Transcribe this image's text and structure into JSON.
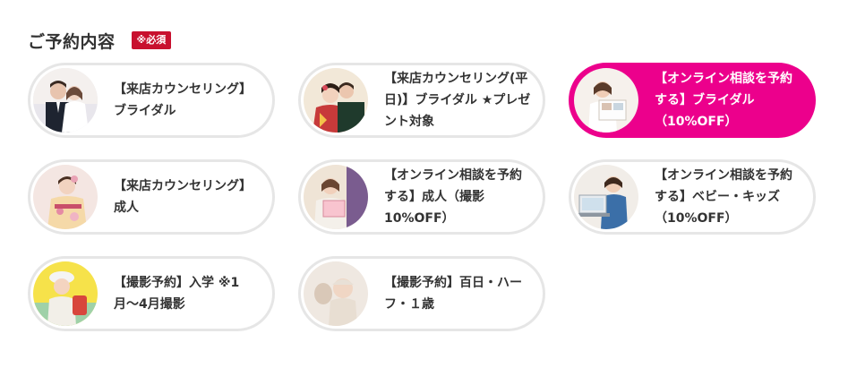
{
  "section": {
    "title": "ご予約内容",
    "required_badge": "※必須"
  },
  "options": [
    {
      "label": "【来店カウンセリング】ブライダル",
      "selected": false,
      "icon": "couple-photo"
    },
    {
      "label": "【来店カウンセリング(平日)】ブライダル ★プレゼント対象",
      "selected": false,
      "icon": "couple-kimono-photo"
    },
    {
      "label": "【オンライン相談を予約する】ブライダル（10%OFF）",
      "selected": true,
      "icon": "online-consult-photo"
    },
    {
      "label": "【来店カウンセリング】成人",
      "selected": false,
      "icon": "furisode-photo"
    },
    {
      "label": "【オンライン相談を予約する】成人（撮影10%OFF）",
      "selected": false,
      "icon": "furisode-online-photo"
    },
    {
      "label": "【オンライン相談を予約する】ベビー・キッズ（10%OFF）",
      "selected": false,
      "icon": "laptop-consult-photo"
    },
    {
      "label": "【撮影予約】入学 ※1月〜4月撮影",
      "selected": false,
      "icon": "school-kid-photo"
    },
    {
      "label": "【撮影予約】百日・ハーフ・１歳",
      "selected": false,
      "icon": "baby-photo"
    }
  ],
  "colors": {
    "accent": "#ec008c",
    "badge": "#c8102e",
    "border": "#e6e6e6"
  }
}
